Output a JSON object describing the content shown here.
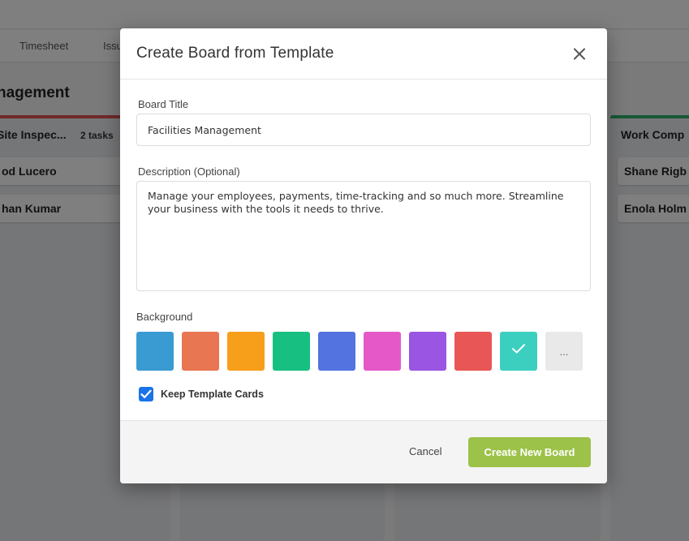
{
  "background_app": {
    "nav_tabs": [
      "Timesheet",
      "Issu"
    ],
    "board_title": "nagement",
    "columns": [
      {
        "title": "Site Inspec...",
        "count": "2 tasks",
        "accent": "#e05252",
        "cards": [
          "od Lucero",
          "han Kumar"
        ]
      },
      {
        "title": "Work Comp",
        "accent": "#2fb36a",
        "cards": [
          "Shane Rigb",
          "Enola Holm"
        ]
      }
    ]
  },
  "modal": {
    "title": "Create Board from Template",
    "close_icon": "close-icon",
    "board_title": {
      "label": "Board Title",
      "value": "Facilities Management"
    },
    "description": {
      "label": "Description (Optional)",
      "value": "Manage your employees, payments, time-tracking and so much more. Streamline your business with the tools it needs to thrive."
    },
    "background": {
      "label": "Background",
      "colors": [
        "#3a9bd3",
        "#e87652",
        "#f79e1b",
        "#17c080",
        "#5273e0",
        "#e558c8",
        "#9a55e3",
        "#e85656",
        "#3ccfbf"
      ],
      "selected_index": 8,
      "more_label": "..."
    },
    "keep_template_cards": {
      "label": "Keep Template Cards",
      "checked": true
    },
    "footer": {
      "cancel_label": "Cancel",
      "create_label": "Create New Board",
      "create_color": "#9cc24a"
    }
  }
}
